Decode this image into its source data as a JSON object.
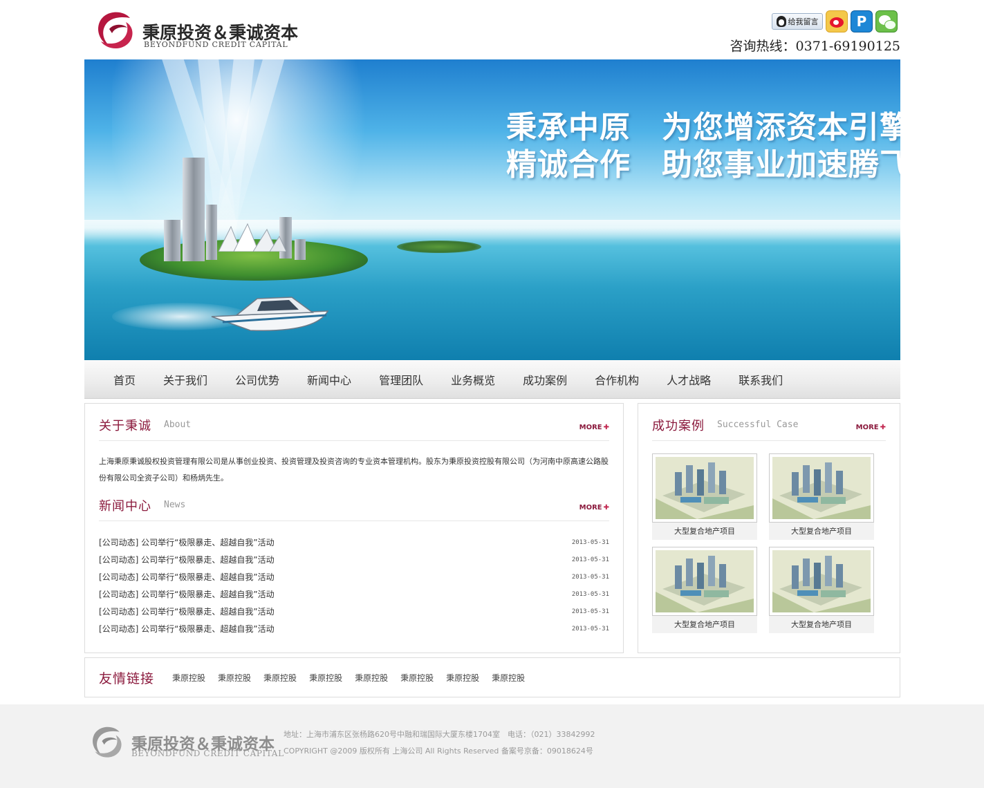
{
  "header": {
    "logo_cn": "秉原投资＆秉诚资本",
    "logo_en": "BEYONDFUND CREDIT CAPITAL",
    "qq_label": "给我留言",
    "hotline": "咨询热线：0371-69190125",
    "social_icons": [
      "qq-message-icon",
      "weibo-icon",
      "pengyou-icon",
      "wechat-icon"
    ]
  },
  "banner": {
    "slogan_line1": "秉承中原　为您增添资本引擎",
    "slogan_line2": "精诚合作　助您事业加速腾飞"
  },
  "nav": {
    "items": [
      "首页",
      "关于我们",
      "公司优势",
      "新闻中心",
      "管理团队",
      "业务概览",
      "成功案例",
      "合作机构",
      "人才战略",
      "联系我们"
    ]
  },
  "about": {
    "title_cn": "关于秉诚",
    "title_en": "About",
    "more": "MORE",
    "text": "上海秉原秉诚股权投资管理有限公司是从事创业投资、投资管理及投资咨询的专业资本管理机构。股东为秉原投资控股有限公司（为河南中原高速公路股份有限公司全资子公司）和杨炳先生。"
  },
  "news": {
    "title_cn": "新闻中心",
    "title_en": "News",
    "more": "MORE",
    "items": [
      {
        "title": "[公司动态] 公司举行“极限暴走、超越自我”活动",
        "date": "2013-05-31"
      },
      {
        "title": "[公司动态] 公司举行“极限暴走、超越自我”活动",
        "date": "2013-05-31"
      },
      {
        "title": "[公司动态] 公司举行“极限暴走、超越自我”活动",
        "date": "2013-05-31"
      },
      {
        "title": "[公司动态] 公司举行“极限暴走、超越自我”活动",
        "date": "2013-05-31"
      },
      {
        "title": "[公司动态] 公司举行“极限暴走、超越自我”活动",
        "date": "2013-05-31"
      },
      {
        "title": "[公司动态] 公司举行“极限暴走、超越自我”活动",
        "date": "2013-05-31"
      }
    ]
  },
  "cases": {
    "title_cn": "成功案例",
    "title_en": "Successful Case",
    "more": "MORE",
    "items": [
      {
        "label": "大型复合地产项目"
      },
      {
        "label": "大型复合地产项目"
      },
      {
        "label": "大型复合地产项目"
      },
      {
        "label": "大型复合地产项目"
      }
    ]
  },
  "links": {
    "title": "友情链接",
    "items": [
      "秉原控股",
      "秉原控股",
      "秉原控股",
      "秉原控股",
      "秉原控股",
      "秉原控股",
      "秉原控股",
      "秉原控股"
    ]
  },
  "footer": {
    "logo_cn": "秉原投资＆秉诚资本",
    "logo_en": "BEYONDFUND CREDIT CAPITAL",
    "address": "地址：上海市浦东区张杨路620号中融和瑞国际大厦东楼1704室　电话：（021）33842992",
    "copyright": "COPYRIGHT @2009 版权所有 上海公司 All Rights Reserved 备案号京备：09018624号"
  },
  "colors": {
    "brand": "#8b1a3d",
    "logo_red": "#b5173f",
    "footer_bg": "#f2f2f2"
  }
}
